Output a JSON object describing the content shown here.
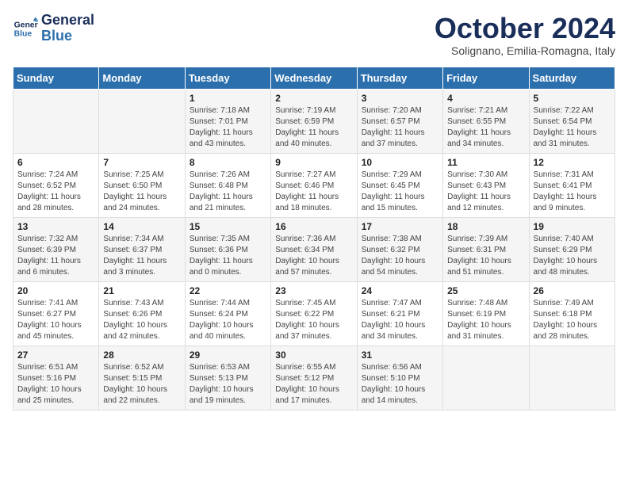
{
  "header": {
    "logo_line1": "General",
    "logo_line2": "Blue",
    "month": "October 2024",
    "location": "Solignano, Emilia-Romagna, Italy"
  },
  "weekdays": [
    "Sunday",
    "Monday",
    "Tuesday",
    "Wednesday",
    "Thursday",
    "Friday",
    "Saturday"
  ],
  "weeks": [
    [
      {
        "day": "",
        "text": ""
      },
      {
        "day": "",
        "text": ""
      },
      {
        "day": "1",
        "text": "Sunrise: 7:18 AM\nSunset: 7:01 PM\nDaylight: 11 hours and 43 minutes."
      },
      {
        "day": "2",
        "text": "Sunrise: 7:19 AM\nSunset: 6:59 PM\nDaylight: 11 hours and 40 minutes."
      },
      {
        "day": "3",
        "text": "Sunrise: 7:20 AM\nSunset: 6:57 PM\nDaylight: 11 hours and 37 minutes."
      },
      {
        "day": "4",
        "text": "Sunrise: 7:21 AM\nSunset: 6:55 PM\nDaylight: 11 hours and 34 minutes."
      },
      {
        "day": "5",
        "text": "Sunrise: 7:22 AM\nSunset: 6:54 PM\nDaylight: 11 hours and 31 minutes."
      }
    ],
    [
      {
        "day": "6",
        "text": "Sunrise: 7:24 AM\nSunset: 6:52 PM\nDaylight: 11 hours and 28 minutes."
      },
      {
        "day": "7",
        "text": "Sunrise: 7:25 AM\nSunset: 6:50 PM\nDaylight: 11 hours and 24 minutes."
      },
      {
        "day": "8",
        "text": "Sunrise: 7:26 AM\nSunset: 6:48 PM\nDaylight: 11 hours and 21 minutes."
      },
      {
        "day": "9",
        "text": "Sunrise: 7:27 AM\nSunset: 6:46 PM\nDaylight: 11 hours and 18 minutes."
      },
      {
        "day": "10",
        "text": "Sunrise: 7:29 AM\nSunset: 6:45 PM\nDaylight: 11 hours and 15 minutes."
      },
      {
        "day": "11",
        "text": "Sunrise: 7:30 AM\nSunset: 6:43 PM\nDaylight: 11 hours and 12 minutes."
      },
      {
        "day": "12",
        "text": "Sunrise: 7:31 AM\nSunset: 6:41 PM\nDaylight: 11 hours and 9 minutes."
      }
    ],
    [
      {
        "day": "13",
        "text": "Sunrise: 7:32 AM\nSunset: 6:39 PM\nDaylight: 11 hours and 6 minutes."
      },
      {
        "day": "14",
        "text": "Sunrise: 7:34 AM\nSunset: 6:37 PM\nDaylight: 11 hours and 3 minutes."
      },
      {
        "day": "15",
        "text": "Sunrise: 7:35 AM\nSunset: 6:36 PM\nDaylight: 11 hours and 0 minutes."
      },
      {
        "day": "16",
        "text": "Sunrise: 7:36 AM\nSunset: 6:34 PM\nDaylight: 10 hours and 57 minutes."
      },
      {
        "day": "17",
        "text": "Sunrise: 7:38 AM\nSunset: 6:32 PM\nDaylight: 10 hours and 54 minutes."
      },
      {
        "day": "18",
        "text": "Sunrise: 7:39 AM\nSunset: 6:31 PM\nDaylight: 10 hours and 51 minutes."
      },
      {
        "day": "19",
        "text": "Sunrise: 7:40 AM\nSunset: 6:29 PM\nDaylight: 10 hours and 48 minutes."
      }
    ],
    [
      {
        "day": "20",
        "text": "Sunrise: 7:41 AM\nSunset: 6:27 PM\nDaylight: 10 hours and 45 minutes."
      },
      {
        "day": "21",
        "text": "Sunrise: 7:43 AM\nSunset: 6:26 PM\nDaylight: 10 hours and 42 minutes."
      },
      {
        "day": "22",
        "text": "Sunrise: 7:44 AM\nSunset: 6:24 PM\nDaylight: 10 hours and 40 minutes."
      },
      {
        "day": "23",
        "text": "Sunrise: 7:45 AM\nSunset: 6:22 PM\nDaylight: 10 hours and 37 minutes."
      },
      {
        "day": "24",
        "text": "Sunrise: 7:47 AM\nSunset: 6:21 PM\nDaylight: 10 hours and 34 minutes."
      },
      {
        "day": "25",
        "text": "Sunrise: 7:48 AM\nSunset: 6:19 PM\nDaylight: 10 hours and 31 minutes."
      },
      {
        "day": "26",
        "text": "Sunrise: 7:49 AM\nSunset: 6:18 PM\nDaylight: 10 hours and 28 minutes."
      }
    ],
    [
      {
        "day": "27",
        "text": "Sunrise: 6:51 AM\nSunset: 5:16 PM\nDaylight: 10 hours and 25 minutes."
      },
      {
        "day": "28",
        "text": "Sunrise: 6:52 AM\nSunset: 5:15 PM\nDaylight: 10 hours and 22 minutes."
      },
      {
        "day": "29",
        "text": "Sunrise: 6:53 AM\nSunset: 5:13 PM\nDaylight: 10 hours and 19 minutes."
      },
      {
        "day": "30",
        "text": "Sunrise: 6:55 AM\nSunset: 5:12 PM\nDaylight: 10 hours and 17 minutes."
      },
      {
        "day": "31",
        "text": "Sunrise: 6:56 AM\nSunset: 5:10 PM\nDaylight: 10 hours and 14 minutes."
      },
      {
        "day": "",
        "text": ""
      },
      {
        "day": "",
        "text": ""
      }
    ]
  ]
}
